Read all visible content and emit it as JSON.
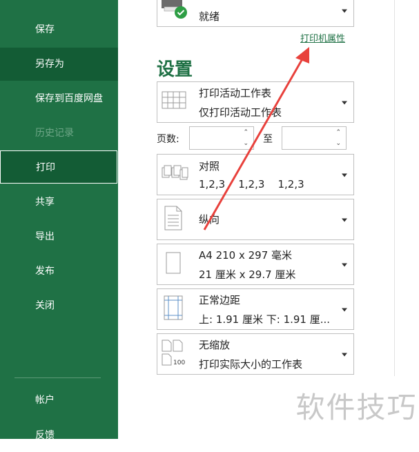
{
  "sidebar": {
    "items": [
      {
        "label": "保存"
      },
      {
        "label": "另存为"
      },
      {
        "label": "保存到百度网盘"
      },
      {
        "label": "历史记录"
      },
      {
        "label": "打印"
      },
      {
        "label": "共享"
      },
      {
        "label": "导出"
      },
      {
        "label": "发布"
      },
      {
        "label": "关闭"
      },
      {
        "label": "帐户"
      },
      {
        "label": "反馈"
      }
    ]
  },
  "printer": {
    "status": "就绪",
    "properties_link": "打印机属性"
  },
  "settings": {
    "title": "设置",
    "print_what": {
      "title": "打印活动工作表",
      "subtitle": "仅打印活动工作表"
    },
    "pages": {
      "label": "页数:",
      "to_label": "至",
      "from_value": "",
      "to_value": ""
    },
    "collate": {
      "title": "对照",
      "subtitle": "1,2,3    1,2,3    1,2,3"
    },
    "orientation": {
      "title": "纵向"
    },
    "paper": {
      "title": "A4 210 x 297 毫米",
      "subtitle": "21 厘米 x 29.7 厘米"
    },
    "margins": {
      "title": "正常边距",
      "subtitle": "上: 1.91 厘米 下: 1.91 厘..."
    },
    "scaling": {
      "title": "无缩放",
      "subtitle": "打印实际大小的工作表",
      "icon_label": "100"
    }
  },
  "watermark": "软件技巧",
  "colors": {
    "sidebar": "#1f7145",
    "accent": "#1f7145",
    "arrow": "#e8413c"
  }
}
